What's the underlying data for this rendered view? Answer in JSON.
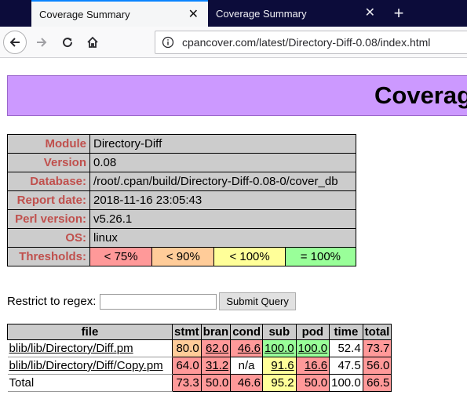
{
  "browser": {
    "tabs": [
      {
        "title": "Coverage Summary",
        "active": true
      },
      {
        "title": "Coverage Summary",
        "active": false
      }
    ],
    "new_tab_icon": "+",
    "url": "cpancover.com/latest/Directory-Diff-0.08/index.html"
  },
  "page": {
    "banner_title": "Coverage Summary",
    "info": [
      {
        "label": "Module",
        "value": "Directory-Diff"
      },
      {
        "label": "Version",
        "value": "0.08"
      },
      {
        "label": "Database:",
        "value": "/root/.cpan/build/Directory-Diff-0.08-0/cover_db"
      },
      {
        "label": "Report date:",
        "value": "2018-11-16 23:05:43"
      },
      {
        "label": "Perl version:",
        "value": "v5.26.1"
      },
      {
        "label": "OS:",
        "value": "linux"
      }
    ],
    "thresholds": {
      "label": "Thresholds:",
      "items": [
        {
          "text": "< 75%",
          "color": "#ff9999"
        },
        {
          "text": "< 90%",
          "color": "#ffcc99"
        },
        {
          "text": "< 100%",
          "color": "#ffff99"
        },
        {
          "text": "= 100%",
          "color": "#99ff99"
        }
      ]
    },
    "regex": {
      "label": "Restrict to regex:",
      "value": "",
      "submit": "Submit Query"
    },
    "coverage": {
      "headers": [
        "file",
        "stmt",
        "bran",
        "cond",
        "sub",
        "pod",
        "time",
        "total"
      ],
      "rows": [
        {
          "file": "blib/lib/Directory/Diff.pm",
          "link": true,
          "stmt": "80.0",
          "bran": "62.0",
          "cond": "46.6",
          "sub": "100.0",
          "pod": "100.0",
          "time": "52.4",
          "total": "73.7"
        },
        {
          "file": "blib/lib/Directory/Diff/Copy.pm",
          "link": true,
          "stmt": "64.0",
          "bran": "31.2",
          "cond": "n/a",
          "sub": "91.6",
          "pod": "16.6",
          "time": "47.5",
          "total": "56.0"
        },
        {
          "file": "Total",
          "link": false,
          "stmt": "73.3",
          "bran": "50.0",
          "cond": "46.6",
          "sub": "95.2",
          "pod": "50.0",
          "time": "100.0",
          "total": "66.5"
        }
      ]
    }
  }
}
